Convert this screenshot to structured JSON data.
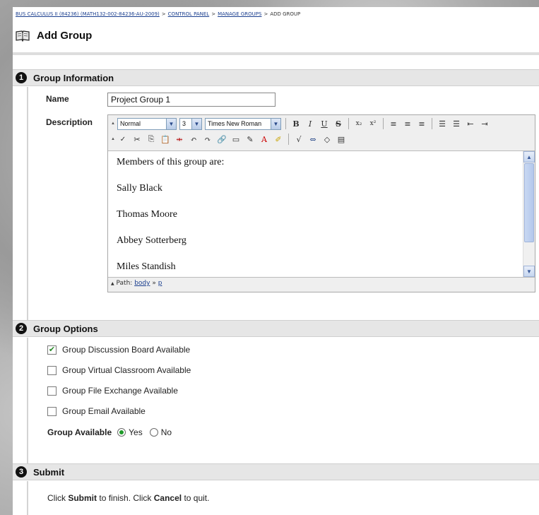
{
  "breadcrumb": {
    "course": "BUS CALCULUS II (84236) (MATH132-002-84236-AU-2009)",
    "control_panel": "CONTROL PANEL",
    "manage_groups": "MANAGE GROUPS",
    "current": "ADD GROUP",
    "separator": ">"
  },
  "page": {
    "title": "Add Group",
    "icon": "book-icon"
  },
  "sections": {
    "info": {
      "number": "1",
      "title": "Group Information",
      "name_label": "Name",
      "name_value": "Project Group 1",
      "description_label": "Description"
    },
    "options": {
      "number": "2",
      "title": "Group Options"
    },
    "submit": {
      "number": "3",
      "title": "Submit"
    }
  },
  "editor": {
    "format": "Normal",
    "size": "3",
    "font": "Times New Roman",
    "content": [
      "Members of this group are:",
      "Sally Black",
      "Thomas Moore",
      "Abbey Sotterberg",
      "Miles Standish"
    ],
    "path_label": "Path:",
    "path_body": "body",
    "path_sep": "»",
    "path_p": "p"
  },
  "options": {
    "checkboxes": [
      {
        "label": "Group Discussion Board Available",
        "checked": true
      },
      {
        "label": "Group Virtual Classroom Available",
        "checked": false
      },
      {
        "label": "Group File Exchange Available",
        "checked": false
      },
      {
        "label": "Group Email Available",
        "checked": false
      }
    ],
    "available_label": "Group Available",
    "yes_label": "Yes",
    "no_label": "No",
    "available_value": "Yes"
  },
  "submit": {
    "prefix": "Click",
    "submit_word": "Submit",
    "middle": "to finish. Click",
    "cancel_word": "Cancel",
    "suffix": "to quit."
  },
  "colors": {
    "link": "#1b3f8f",
    "section_bg": "#e6e6e6",
    "check_green": "#2a8a2a"
  }
}
